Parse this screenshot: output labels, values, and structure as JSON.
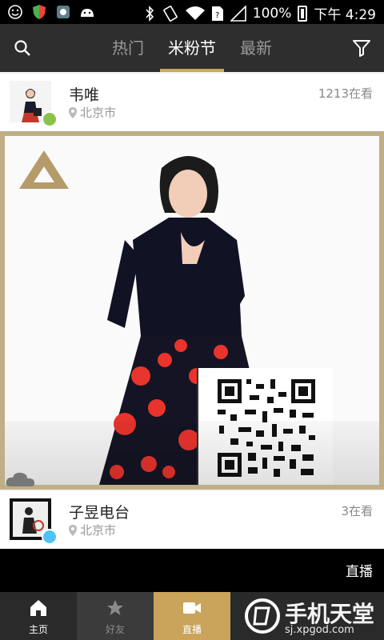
{
  "status_bar": {
    "battery": "100%",
    "time": "下午 4:29",
    "icons": [
      "emoji-icon",
      "shield-icon",
      "app-icon",
      "android-icon",
      "bluetooth-icon",
      "vibrate-icon",
      "wifi-icon",
      "sim-icon",
      "signal-icon",
      "battery-icon"
    ]
  },
  "header": {
    "tabs": [
      {
        "label": "热门",
        "active": false
      },
      {
        "label": "米粉节",
        "active": true
      },
      {
        "label": "最新",
        "active": false
      }
    ],
    "accent_color": "#c8a85a"
  },
  "feed": [
    {
      "name": "韦唯",
      "location": "北京市",
      "viewers": "1213在看",
      "badge_color": "#8bc34a"
    },
    {
      "name": "子昱电台",
      "location": "北京市",
      "viewers": "3在看",
      "badge_color": "#4fc3f7"
    }
  ],
  "live_bar": {
    "label": "直播"
  },
  "bottom_nav": [
    {
      "label": "主页"
    },
    {
      "label": "好友"
    },
    {
      "label": "直播"
    }
  ],
  "watermark": {
    "title": "手机天堂",
    "url": "sj.xpgod.com"
  }
}
